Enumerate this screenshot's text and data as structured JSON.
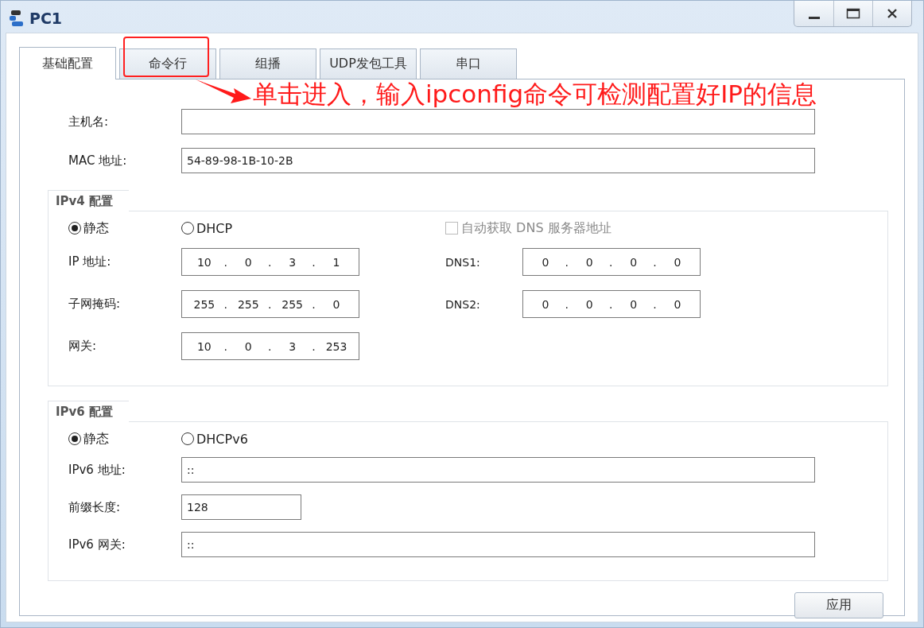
{
  "window": {
    "title": "PC1"
  },
  "tabs": [
    {
      "label": "基础配置",
      "selected": true
    },
    {
      "label": "命令行",
      "selected": false
    },
    {
      "label": "组播",
      "selected": false
    },
    {
      "label": "UDP发包工具",
      "selected": false
    },
    {
      "label": "串口",
      "selected": false
    }
  ],
  "annotation": {
    "text": "单击进入，输入ipconfig命令可检测配置好IP的信息"
  },
  "host_fields": [
    {
      "label": "主机名:"
    },
    {
      "label": "MAC 地址:",
      "value": "54-89-98-1B-10-2B"
    }
  ],
  "ipv4": {
    "title": "IPv4 配置",
    "octet_separator": ".",
    "modes": [
      {
        "label": "静态",
        "selected": true
      },
      {
        "label": "DHCP",
        "selected": false
      }
    ],
    "auto_dns": {
      "label": "自动获取 DNS 服务器地址",
      "checked": false,
      "disabled": true
    },
    "rows": [
      {
        "label": "IP 地址:",
        "octets": [
          "10",
          "0",
          "3",
          "1"
        ],
        "dns_label": "DNS1:",
        "dns_octets": [
          "0",
          "0",
          "0",
          "0"
        ]
      },
      {
        "label": "子网掩码:",
        "octets": [
          "255",
          "255",
          "255",
          "0"
        ],
        "dns_label": "DNS2:",
        "dns_octets": [
          "0",
          "0",
          "0",
          "0"
        ]
      },
      {
        "label": "网关:",
        "octets": [
          "10",
          "0",
          "3",
          "253"
        ]
      }
    ]
  },
  "ipv6": {
    "title": "IPv6 配置",
    "modes": [
      {
        "label": "静态",
        "selected": true
      },
      {
        "label": "DHCPv6",
        "selected": false
      }
    ],
    "fields": [
      {
        "label": "IPv6 地址:",
        "value": "::",
        "kind": "wide"
      },
      {
        "label": "前缀长度:",
        "value": "128",
        "kind": "short"
      },
      {
        "label": "IPv6 网关:",
        "value": "::",
        "kind": "wide"
      }
    ]
  },
  "apply_button": "应用"
}
